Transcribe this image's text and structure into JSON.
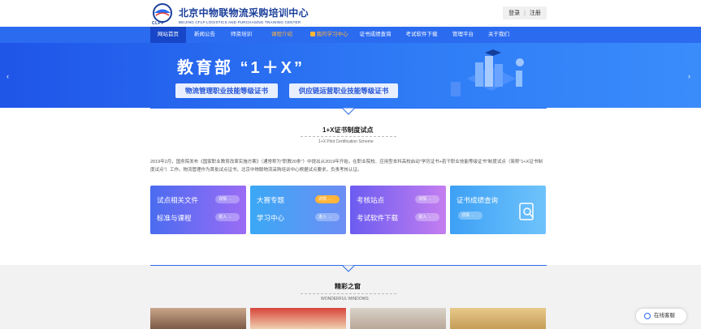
{
  "header": {
    "logo_cn": "北京中物联物流采购培训中心",
    "logo_en": "BEIJING CFLP LOGISTICS AND PURCHASING TRAINING CENTER",
    "logo_abbr": "CLPP",
    "login": "登录",
    "register": "注册"
  },
  "nav": {
    "items": [
      {
        "label": "网站首页"
      },
      {
        "label": "新闻公告"
      },
      {
        "label": "师资培训"
      },
      {
        "label": "课程介绍"
      },
      {
        "label": "我的学习中心"
      },
      {
        "label": "证书成绩查询"
      },
      {
        "label": "考试软件下载"
      },
      {
        "label": "管理平台"
      },
      {
        "label": "关于我们"
      }
    ],
    "active_index": 0
  },
  "banner": {
    "title": "教育部 “1＋X”",
    "cert1": "物流管理职业技能等级证书",
    "cert2": "供应链运营职业技能等级证书",
    "prev_icon": "chevron-left-icon",
    "next_icon": "chevron-right-icon"
  },
  "pilot": {
    "title": "1+X证书制度试点",
    "subtitle": "1+X Pilot Certification Scheme",
    "paragraph": "2019年2月，国务院发布《国家职业教育改革实施方案》（通常称为\"职教20条\"）中提出从2019年开始，在职业院校、应用型本科高校启动\"学历证书+若干职业技能等级证书\"制度试点（简称\"1+X证书制度试点\"）工作。物流管理作为首批试点证书，北京中物联物流采购培训中心根据试点要求，负责考核认证。"
  },
  "cards": [
    {
      "line1": "试点相关文件",
      "btn1": "详情 →",
      "line2": "标准与课程",
      "btn2": "进入 →",
      "colors": [
        "#4a6cf0",
        "#9b6cf5"
      ]
    },
    {
      "line1": "大赛专题",
      "btn1": "详情 →",
      "line2": "学习中心",
      "btn2": "进入 →",
      "colors": [
        "#3aa8f5",
        "#6e8ef5"
      ]
    },
    {
      "line1": "考核站点",
      "btn1": "详情 →",
      "line2": "考试软件下载",
      "btn2": "进入 →",
      "colors": [
        "#6b5cf0",
        "#c47ef0"
      ]
    },
    {
      "line1": "证书成绩查询",
      "btn1": "详情 →",
      "line2": "",
      "btn2": "",
      "colors": [
        "#3da0f5",
        "#6fc3fb"
      ]
    }
  ],
  "wonderful": {
    "title": "精彩之窗",
    "subtitle": "WONDERFUL WINDOWS"
  },
  "chat": {
    "label": "在线客服"
  },
  "colors": {
    "primary": "#2b6bf0",
    "nav_active": "#1747c8",
    "accent": "#ffb43a"
  }
}
